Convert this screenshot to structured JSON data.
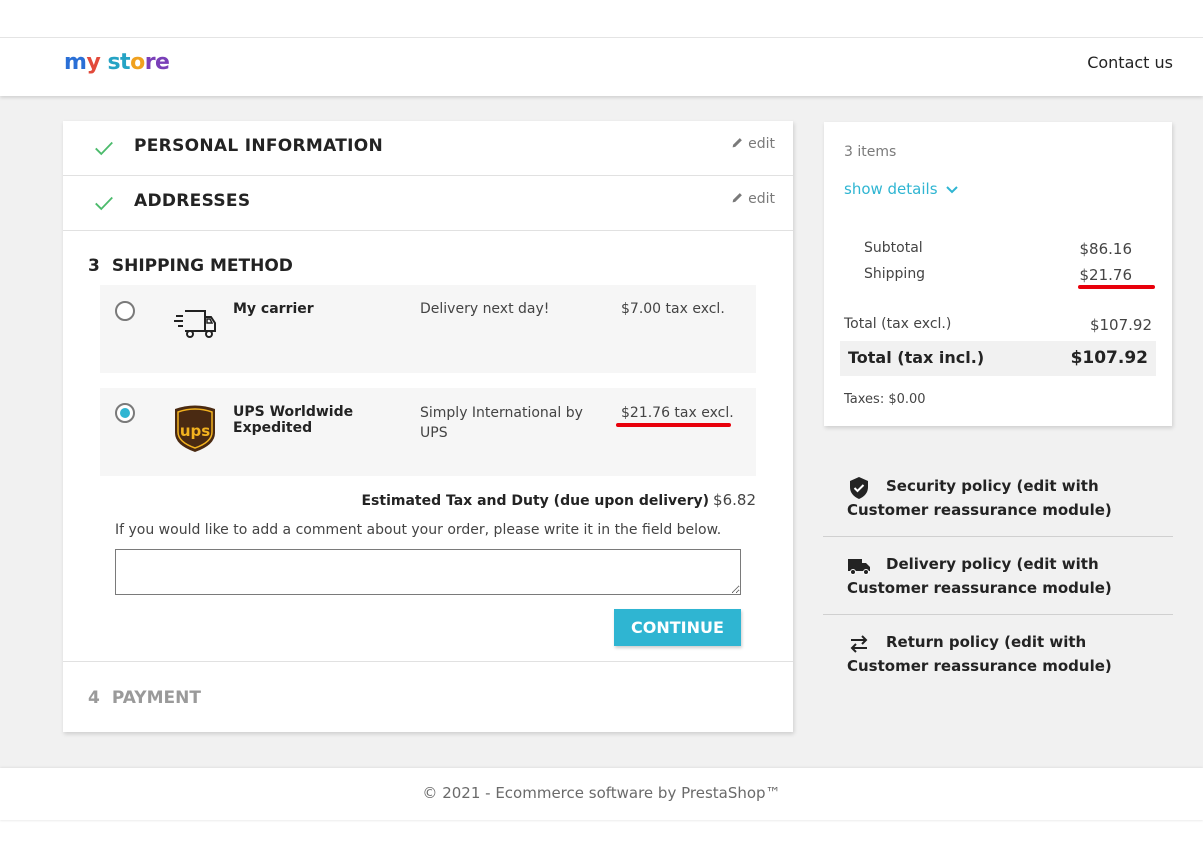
{
  "header": {
    "logo_parts": [
      "m",
      "y",
      " st",
      "o",
      "re"
    ],
    "logo_text": "my store",
    "contact_label": "Contact us"
  },
  "steps": {
    "personal": {
      "title": "PERSONAL INFORMATION",
      "edit_label": "edit"
    },
    "addresses": {
      "title": "ADDRESSES",
      "edit_label": "edit"
    },
    "shipping": {
      "number": "3",
      "title": "SHIPPING METHOD"
    },
    "payment": {
      "number": "4",
      "title": "PAYMENT"
    }
  },
  "carriers": [
    {
      "name": "My carrier",
      "delay": "Delivery next day!",
      "price": "$7.00 tax excl.",
      "selected": false,
      "icon": "truck-icon"
    },
    {
      "name": "UPS Worldwide Expedited",
      "delay": "Simply International by UPS",
      "price": "$21.76 tax excl.",
      "selected": true,
      "icon": "ups-logo"
    }
  ],
  "estimated": {
    "label": "Estimated Tax and Duty (due upon delivery)",
    "value": "$6.82"
  },
  "comment": {
    "label": "If you would like to add a comment about your order, please write it in the field below.",
    "value": ""
  },
  "continue_label": "CONTINUE",
  "summary": {
    "items_count": "3 items",
    "show_details": "show details",
    "subtotal_label": "Subtotal",
    "subtotal_value": "$86.16",
    "shipping_label": "Shipping",
    "shipping_value": "$21.76",
    "total_excl_label": "Total (tax excl.)",
    "total_excl_value": "$107.92",
    "total_incl_label": "Total (tax incl.)",
    "total_incl_value": "$107.92",
    "taxes": "Taxes: $0.00"
  },
  "reassurance": [
    {
      "icon": "shield-icon",
      "text": "Security policy (edit with Customer reassurance module)"
    },
    {
      "icon": "truck-icon",
      "text": "Delivery policy (edit with Customer reassurance module)"
    },
    {
      "icon": "swap-arrows-icon",
      "text": "Return policy (edit with Customer reassurance module)"
    }
  ],
  "footer": {
    "copyright": "© 2021 - Ecommerce software by PrestaShop™"
  },
  "colors": {
    "accent": "#2fb5d2",
    "check": "#4cbb6c",
    "highlight": "#e8000b",
    "background": "#f1f1f1"
  }
}
